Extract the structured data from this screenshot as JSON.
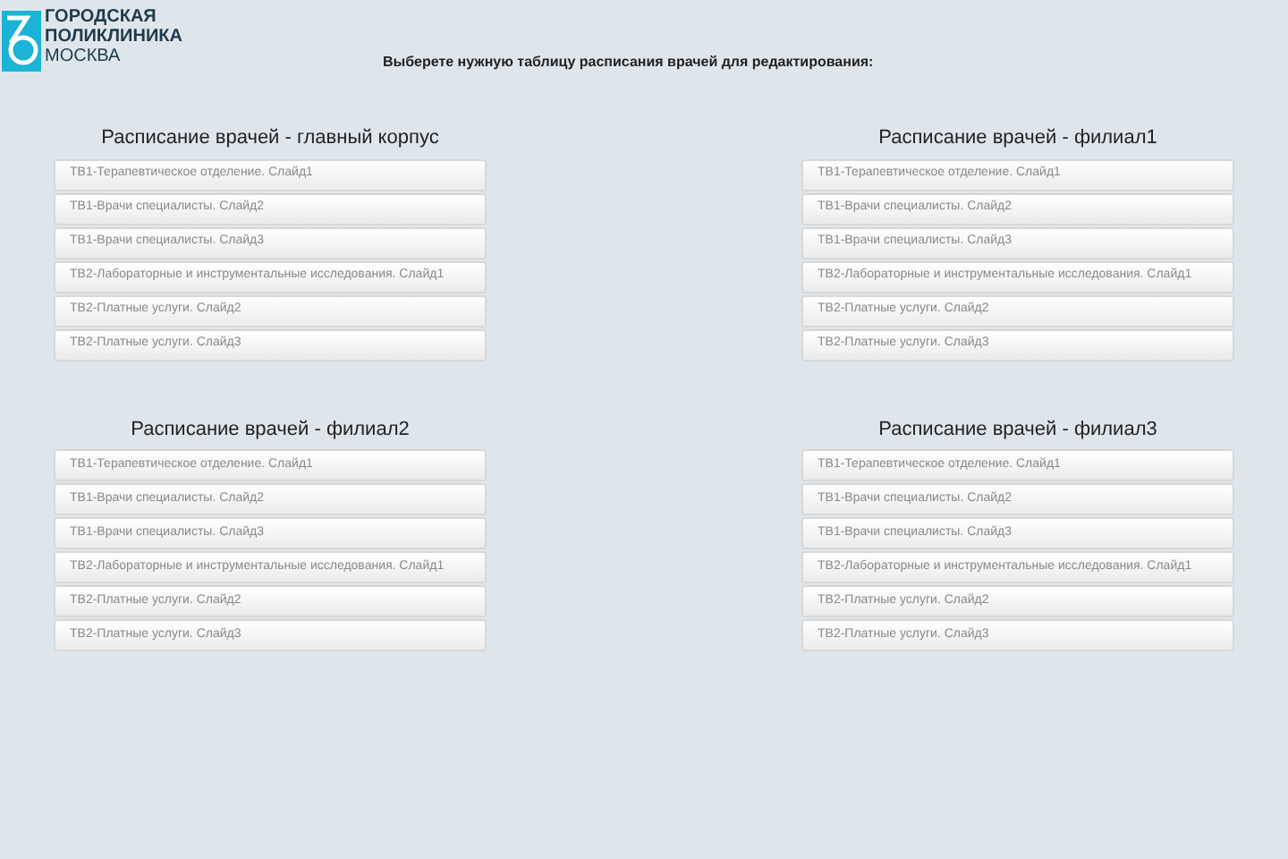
{
  "logo": {
    "lines": [
      "ГОРОДСКАЯ",
      "ПОЛИКЛИНИКА",
      "МОСКВА"
    ]
  },
  "heading": "Выберете нужную таблицу расписания врачей для редактирования:",
  "schedules": [
    {
      "title": "Расписание врачей - главный корпус",
      "items": [
        "ТВ1-Терапевтическое отделение. Слайд1",
        "ТВ1-Врачи специалисты. Слайд2",
        "ТВ1-Врачи специалисты. Слайд3",
        "ТВ2-Лабораторные и инструментальные исследования. Слайд1",
        "ТВ2-Платные услуги. Слайд2",
        "ТВ2-Платные услуги. Слайд3"
      ]
    },
    {
      "title": "Расписание врачей - филиал1",
      "items": [
        "ТВ1-Терапевтическое отделение. Слайд1",
        "ТВ1-Врачи специалисты. Слайд2",
        "ТВ1-Врачи специалисты. Слайд3",
        "ТВ2-Лабораторные и инструментальные исследования. Слайд1",
        "ТВ2-Платные услуги. Слайд2",
        "ТВ2-Платные услуги. Слайд3"
      ]
    },
    {
      "title": "Расписание врачей - филиал2",
      "items": [
        "ТВ1-Терапевтическое отделение. Слайд1",
        "ТВ1-Врачи специалисты. Слайд2",
        "ТВ1-Врачи специалисты. Слайд3",
        "ТВ2-Лабораторные и инструментальные исследования. Слайд1",
        "ТВ2-Платные услуги. Слайд2",
        "ТВ2-Платные услуги. Слайд3"
      ]
    },
    {
      "title": "Расписание врачей - филиал3",
      "items": [
        "ТВ1-Терапевтическое отделение. Слайд1",
        "ТВ1-Врачи специалисты. Слайд2",
        "ТВ1-Врачи специалисты. Слайд3",
        "ТВ2-Лабораторные и инструментальные исследования. Слайд1",
        "ТВ2-Платные услуги. Слайд2",
        "ТВ2-Платные услуги. Слайд3"
      ]
    }
  ]
}
